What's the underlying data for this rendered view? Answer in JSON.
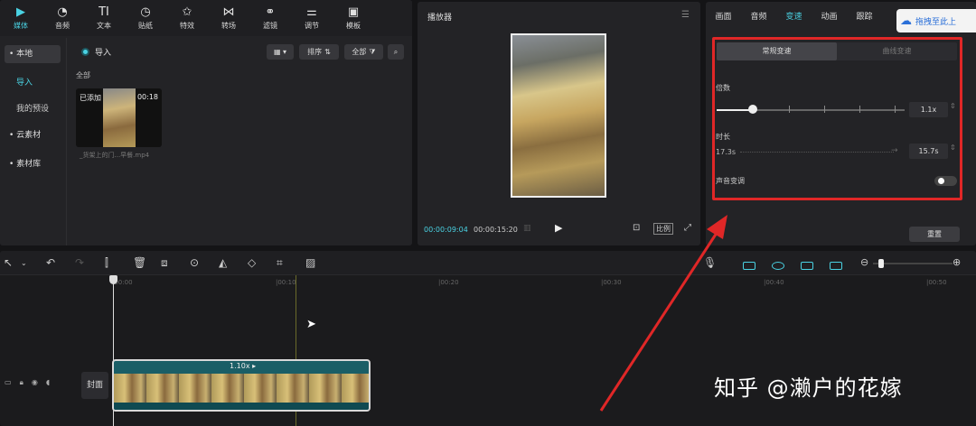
{
  "media_panel": {
    "tabs": [
      {
        "label": "媒体",
        "icon": "media-icon",
        "active": true
      },
      {
        "label": "音频",
        "icon": "audio-icon"
      },
      {
        "label": "文本",
        "icon": "text-icon"
      },
      {
        "label": "贴纸",
        "icon": "sticker-icon"
      },
      {
        "label": "特效",
        "icon": "effects-icon"
      },
      {
        "label": "转场",
        "icon": "transition-icon"
      },
      {
        "label": "滤镜",
        "icon": "filter-icon"
      },
      {
        "label": "调节",
        "icon": "adjust-icon"
      },
      {
        "label": "模板",
        "icon": "template-icon"
      }
    ],
    "sidebar": {
      "local": "• 本地",
      "import": "导入",
      "presets": "我的预设",
      "cloud": "• 云素材",
      "library": "• 素材库"
    },
    "import_label": "导入",
    "all_label": "全部",
    "sort_label": "排序",
    "filter_label": "全部",
    "clip": {
      "added": "已添加",
      "duration": "00:18",
      "filename": "_货架上的门...早餐.mp4"
    }
  },
  "player": {
    "title": "播放器",
    "current_time": "00:00:09:04",
    "total_time": "00:00:15:20",
    "ratio_label": "比例"
  },
  "props": {
    "tabs": [
      "画面",
      "音频",
      "变速",
      "动画",
      "跟踪"
    ],
    "active_tab": "变速",
    "badge": "拖拽至此上",
    "speed_modes": [
      "常规变速",
      "曲线变速"
    ],
    "multiplier_label": "倍数",
    "multiplier_value": "1.1x",
    "multiplier_fraction": 0.19,
    "duration_label": "时长",
    "duration_from": "17.3s",
    "duration_to": "15.7s",
    "pitch_label": "声音变调",
    "reset_label": "重置"
  },
  "timeline": {
    "ruler": [
      "|00:00",
      "|00:10",
      "|00:20",
      "|00:30",
      "|00:40",
      "|00:50"
    ],
    "clip_speed": "1.10x ▸",
    "cover_label": "封面"
  },
  "watermark": "知乎 @濑户的花嫁",
  "colors": {
    "accent": "#4ad2e3",
    "highlight": "#e02727"
  }
}
